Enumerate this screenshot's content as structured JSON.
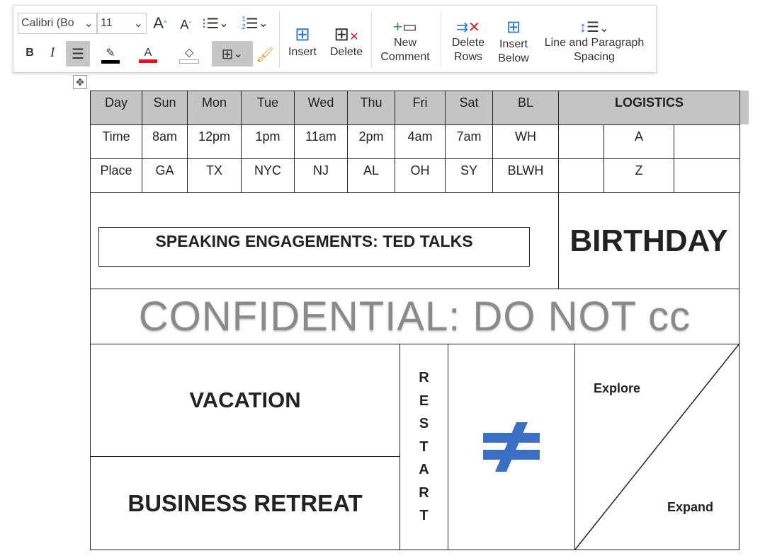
{
  "toolbar": {
    "font_name": "Calibri (Bo",
    "font_size": "11",
    "bold": "B",
    "italic": "I",
    "insert": "Insert",
    "delete": "Delete",
    "new_comment": [
      "New",
      "Comment"
    ],
    "delete_rows": [
      "Delete",
      "Rows"
    ],
    "insert_below": [
      "Insert",
      "Below"
    ],
    "line_spacing": [
      "Line and Paragraph",
      "Spacing"
    ],
    "colors": {
      "highlight": "#000000",
      "font_color": "#e81123",
      "accent": "#2e75d0"
    }
  },
  "table": {
    "header": [
      "Day",
      "Sun",
      "Mon",
      "Tue",
      "Wed",
      "Thu",
      "Fri",
      "Sat",
      "BL",
      "LOGISTICS"
    ],
    "time_row": [
      "Time",
      "8am",
      "12pm",
      "1pm",
      "11am",
      "2pm",
      "4am",
      "7am",
      "WH",
      "",
      "A",
      ""
    ],
    "place_row": [
      "Place",
      "GA",
      "TX",
      "NYC",
      "NJ",
      "AL",
      "OH",
      "SY",
      "BLWH",
      "",
      "Z",
      ""
    ],
    "speaking": "SPEAKING ENGAGEMENTS: TED TALKS",
    "birthday": "BIRTHDAY",
    "confidential": "CONFIDENTIAL: DO NOT cc",
    "vacation": "VACATION",
    "business_retreat": "BUSINESS RETREAT",
    "restart": [
      "R",
      "E",
      "S",
      "T",
      "A",
      "R",
      "T"
    ],
    "not_equal": "≠",
    "explore": "Explore",
    "expand": "Expand"
  }
}
